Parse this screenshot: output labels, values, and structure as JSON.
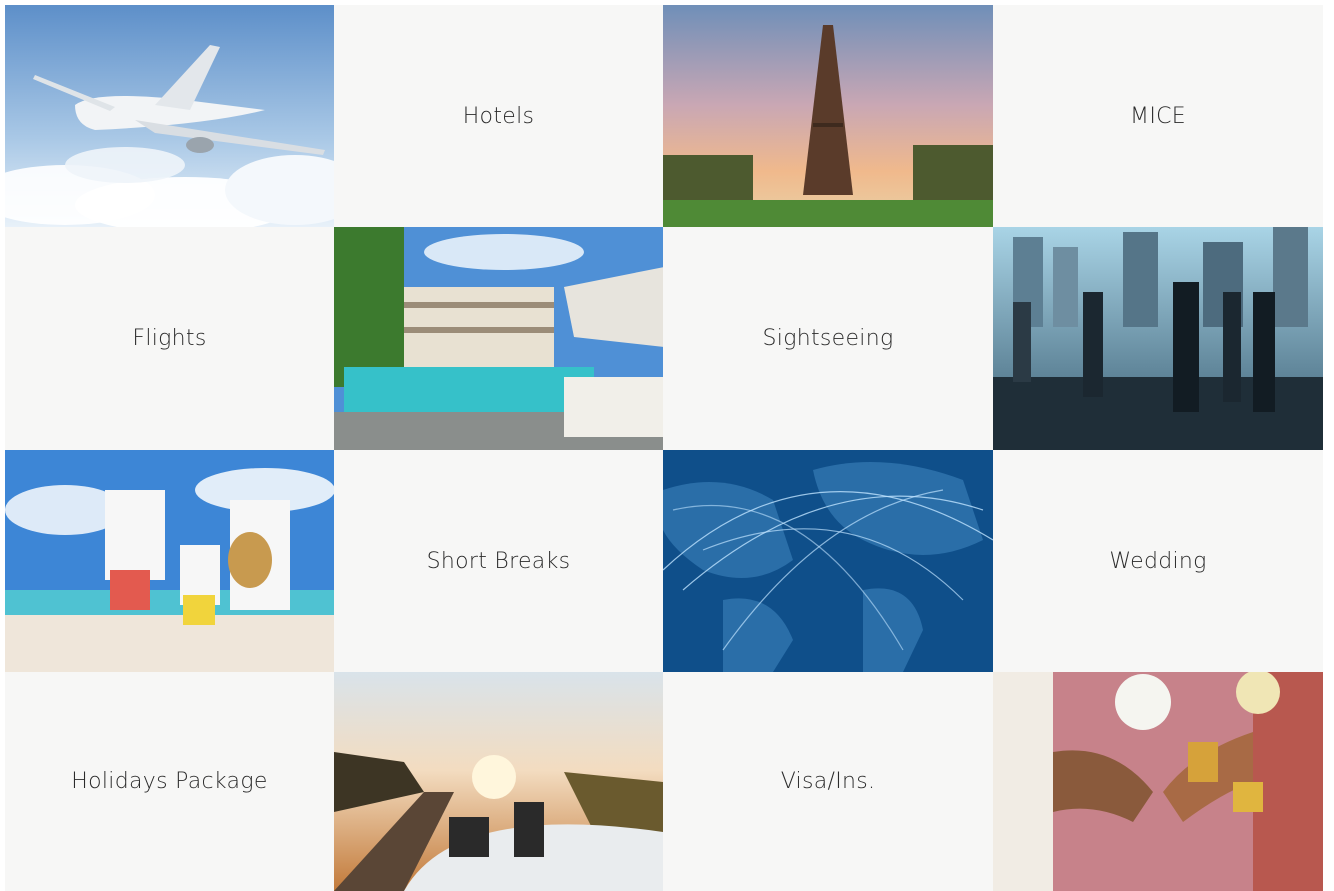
{
  "tiles": {
    "hotels": "Hotels",
    "mice": "MICE",
    "flights": "Flights",
    "sightseeing": "Sightseeing",
    "short_breaks": "Short Breaks",
    "wedding": "Wedding",
    "holidays_package": "Holidays Package",
    "visa_ins": "Visa/Ins."
  },
  "photos": [
    "airplane-in-sky",
    "eiffel-tower-sunset",
    "resort-pool",
    "business-travellers-skyline",
    "family-on-beach",
    "world-flight-routes-map",
    "convertible-sunset-road",
    "wedding-hands"
  ]
}
